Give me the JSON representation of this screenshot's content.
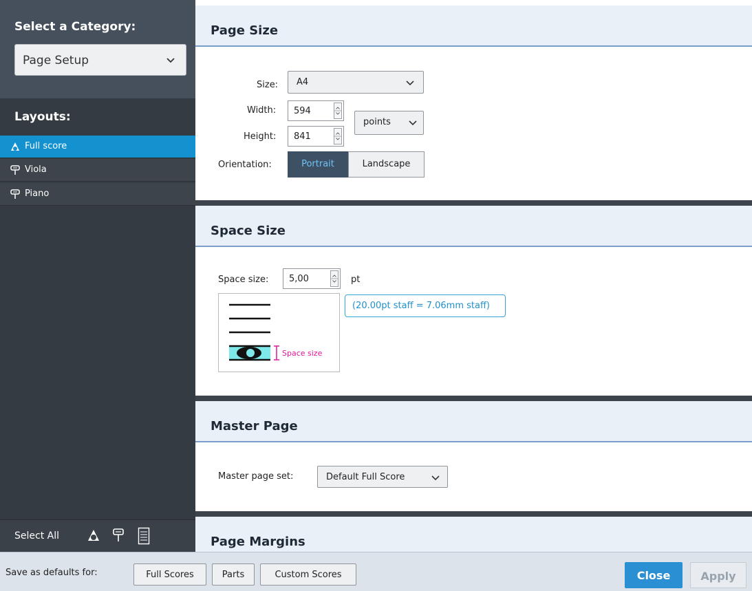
{
  "sidebar": {
    "category_title": "Select a Category:",
    "category_value": "Page Setup",
    "layouts_title": "Layouts:",
    "layouts": [
      {
        "label": "Full score",
        "icon": "full-score-icon",
        "selected": true
      },
      {
        "label": "Viola",
        "icon": "part-icon",
        "selected": false
      },
      {
        "label": "Piano",
        "icon": "part-icon",
        "selected": false
      }
    ],
    "select_all_label": "Select All",
    "select_icons": [
      "select-full-scores-icon",
      "select-parts-icon",
      "select-custom-scores-icon"
    ]
  },
  "page_size": {
    "title": "Page Size",
    "size_label": "Size:",
    "size_value": "A4",
    "width_label": "Width:",
    "width_value": "594",
    "height_label": "Height:",
    "height_value": "841",
    "units_value": "points",
    "orientation_label": "Orientation:",
    "portrait_label": "Portrait",
    "landscape_label": "Landscape",
    "orientation_selected": "Portrait"
  },
  "space_size": {
    "title": "Space Size",
    "label": "Space size:",
    "value": "5,00",
    "unit": "pt",
    "calc_note": "(20.00pt staff = 7.06mm staff)",
    "diagram_label": "Space size"
  },
  "master_page": {
    "title": "Master Page",
    "label": "Master page set:",
    "value": "Default Full Score"
  },
  "page_margins": {
    "title": "Page Margins"
  },
  "footer": {
    "save_label": "Save as defaults for:",
    "full_scores": "Full Scores",
    "parts": "Parts",
    "custom_scores": "Custom Scores",
    "close": "Close",
    "apply": "Apply"
  },
  "colors": {
    "accent": "#1492d0",
    "sidebar_bg": "#353b42",
    "section_header_bg": "#eaf0f7",
    "staff_highlight": "#7fe8e8",
    "space_size_magenta": "#e0169b"
  }
}
